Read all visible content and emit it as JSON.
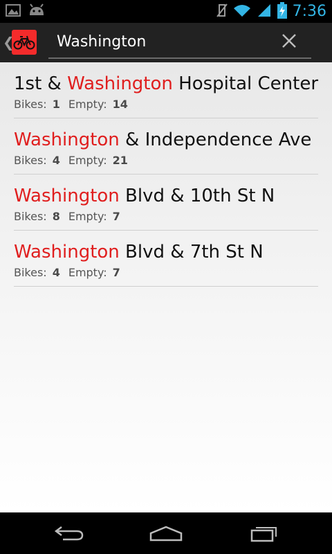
{
  "status_bar": {
    "time": "7:36",
    "icons_left": [
      "gallery-icon",
      "android-icon"
    ],
    "icons_right": [
      "no-vibrate-icon",
      "wifi-icon",
      "signal-icon",
      "battery-charging-icon"
    ]
  },
  "search": {
    "query": "Washington"
  },
  "stations": [
    {
      "before": "1st & ",
      "match": "Washington",
      "after": " Hospital Center",
      "bikes_label": "Bikes:",
      "bikes": "1",
      "empty_label": "Empty:",
      "empty": "14"
    },
    {
      "before": "",
      "match": "Washington",
      "after": " & Independence Ave",
      "bikes_label": "Bikes:",
      "bikes": "4",
      "empty_label": "Empty:",
      "empty": "21"
    },
    {
      "before": "",
      "match": "Washington",
      "after": " Blvd & 10th St N",
      "bikes_label": "Bikes:",
      "bikes": "8",
      "empty_label": "Empty:",
      "empty": "7"
    },
    {
      "before": "",
      "match": "Washington",
      "after": " Blvd & 7th St N",
      "bikes_label": "Bikes:",
      "bikes": "4",
      "empty_label": "Empty:",
      "empty": "7"
    }
  ],
  "colors": {
    "accent": "#33b5e5",
    "highlight": "#e01e1e",
    "app_icon": "#f42b2b"
  },
  "nav_bar": {
    "buttons": [
      "back-icon",
      "home-icon",
      "recents-icon"
    ]
  }
}
